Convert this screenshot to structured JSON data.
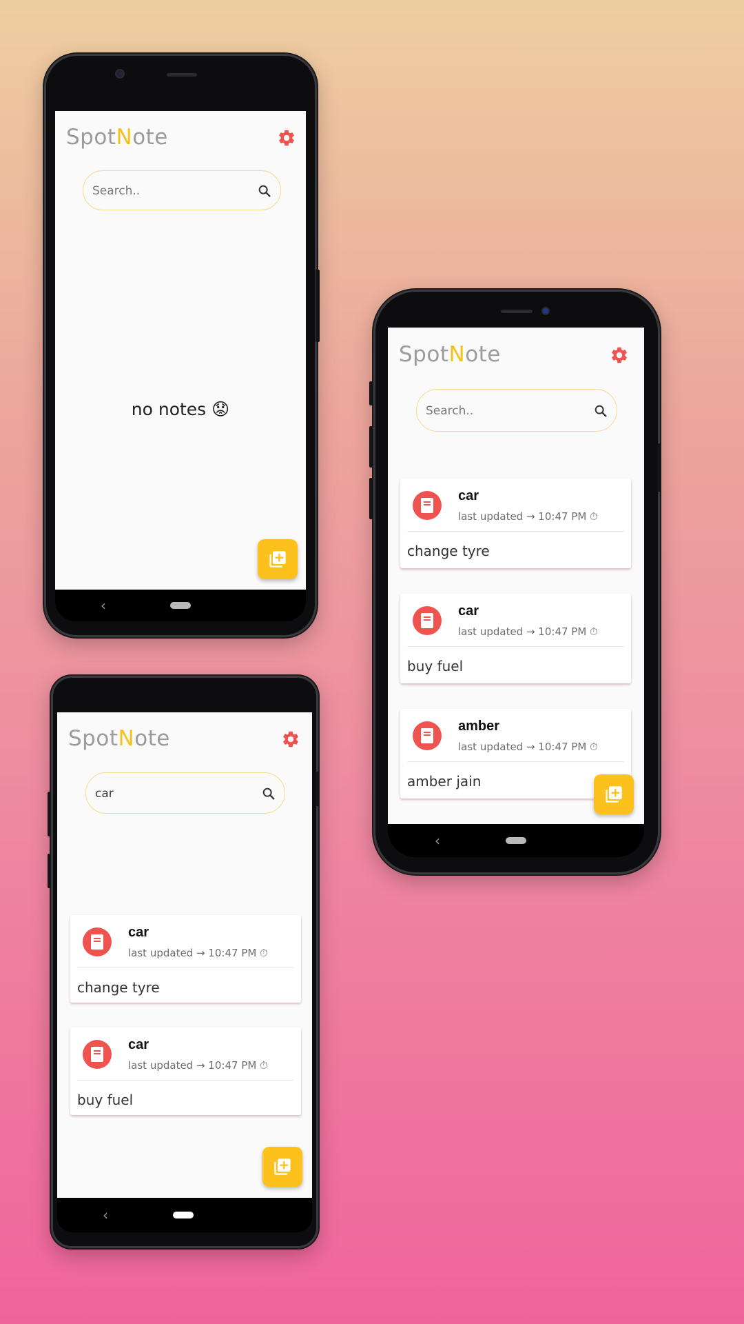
{
  "app": {
    "logo_prefix": "Spot",
    "logo_accent": "N",
    "logo_suffix": "ote",
    "accent_color": "#f4c21b",
    "gear_color": "#ef5350",
    "fab_color": "#fdc11d"
  },
  "phone_empty": {
    "search_placeholder": "Search..",
    "empty_message": "no notes 😟",
    "nav_back": "‹"
  },
  "phone_list": {
    "search_placeholder": "Search..",
    "nav_back": "‹",
    "notes": [
      {
        "title": "car",
        "meta": "last updated → 10:47 PM ⏱",
        "body": "change tyre"
      },
      {
        "title": "car",
        "meta": "last updated → 10:47 PM ⏱",
        "body": "buy fuel"
      },
      {
        "title": "amber",
        "meta": "last updated → 10:47 PM ⏱",
        "body": "amber jain"
      }
    ]
  },
  "phone_search": {
    "search_value": "car",
    "nav_back": "‹",
    "notes": [
      {
        "title": "car",
        "meta": "last updated → 10:47 PM ⏱",
        "body": "change tyre"
      },
      {
        "title": "car",
        "meta": "last updated → 10:47 PM ⏱",
        "body": "buy fuel"
      }
    ]
  }
}
